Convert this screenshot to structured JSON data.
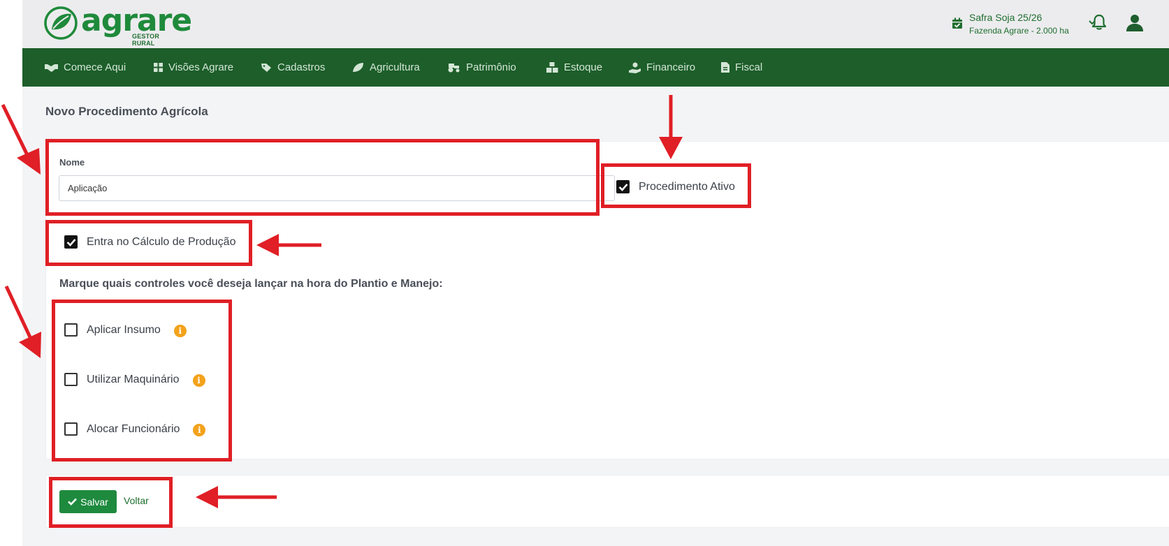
{
  "brand": {
    "name": "agrare",
    "subtitle": "GESTOR RURAL",
    "color": "#1f8a3b"
  },
  "header": {
    "season_title": "Safra Soja 25/26",
    "season_subtitle": "Fazenda Agrare - 2.000 ha",
    "icons": [
      "calendar-check-icon",
      "chevron-down-icon",
      "bell-icon",
      "user-icon"
    ]
  },
  "nav": {
    "items": [
      {
        "label": "Comece Aqui",
        "icon": "handshake-icon"
      },
      {
        "label": "Visões Agrare",
        "icon": "grid-icon"
      },
      {
        "label": "Cadastros",
        "icon": "tag-icon"
      },
      {
        "label": "Agricultura",
        "icon": "leaf-icon"
      },
      {
        "label": "Patrimônio",
        "icon": "tractor-icon"
      },
      {
        "label": "Estoque",
        "icon": "boxes-icon"
      },
      {
        "label": "Financeiro",
        "icon": "hand-coin-icon"
      },
      {
        "label": "Fiscal",
        "icon": "file-invoice-icon"
      }
    ],
    "bg_color": "#1d5e2a"
  },
  "page": {
    "title": "Novo Procedimento Agrícola"
  },
  "form": {
    "nome_label": "Nome",
    "nome_value": "Aplicação",
    "ativo_label": "Procedimento Ativo",
    "ativo_checked": true,
    "calculo_label": "Entra no Cálculo de Produção",
    "calculo_checked": true,
    "controls_question": "Marque quais controles você deseja lançar na hora do Plantio e Manejo:",
    "controls": [
      {
        "label": "Aplicar Insumo",
        "checked": false
      },
      {
        "label": "Utilizar Maquinário",
        "checked": false
      },
      {
        "label": "Alocar Funcionário",
        "checked": false
      }
    ]
  },
  "actions": {
    "save_label": "Salvar",
    "back_label": "Voltar",
    "save_color": "#1e8a3e"
  },
  "annotation_color": "#e01f26"
}
